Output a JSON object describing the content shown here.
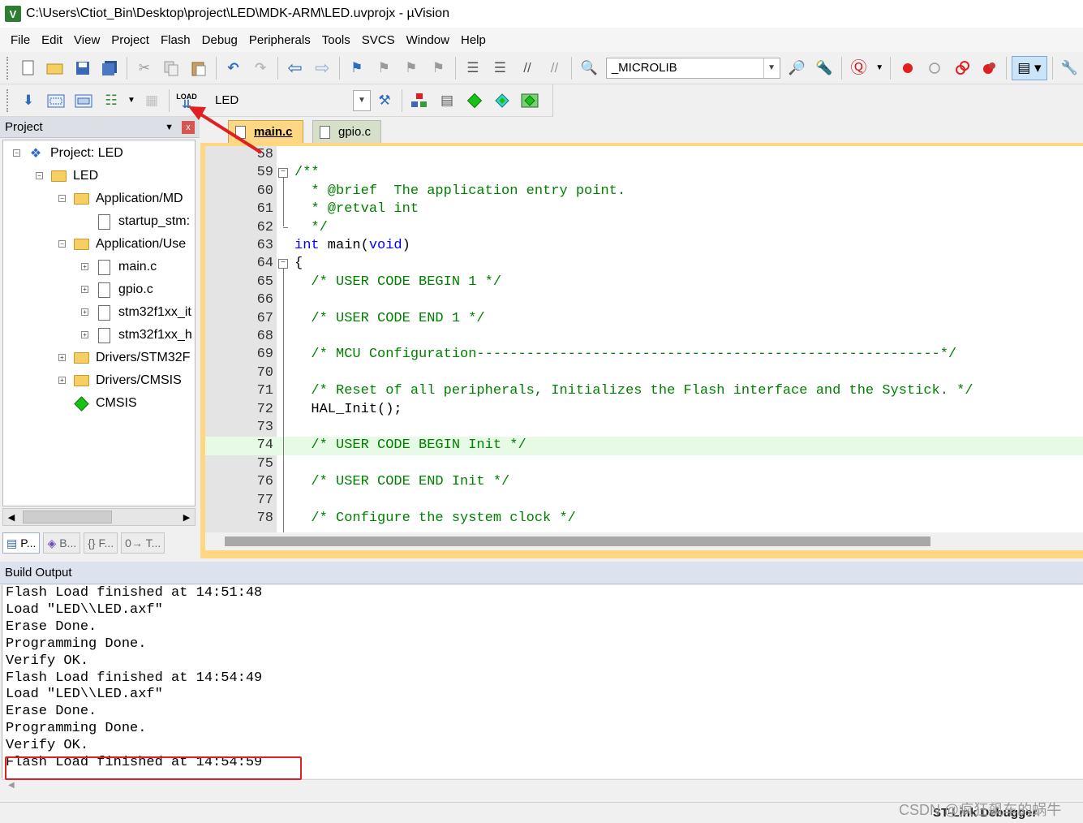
{
  "window": {
    "title": "C:\\Users\\Ctiot_Bin\\Desktop\\project\\LED\\MDK-ARM\\LED.uvprojx - µVision",
    "icon_letter": "V"
  },
  "menu": [
    "File",
    "Edit",
    "View",
    "Project",
    "Flash",
    "Debug",
    "Peripherals",
    "Tools",
    "SVCS",
    "Window",
    "Help"
  ],
  "toolbar1": {
    "target_combo": "_MICROLIB"
  },
  "toolbar2": {
    "load_label": "LOAD",
    "target_combo": "LED"
  },
  "project_panel": {
    "title": "Project",
    "pin_glyph": "▼",
    "close_glyph": "x",
    "tree": [
      {
        "label": "Project: LED",
        "level": 0,
        "icon": "project-icon",
        "toggle": "⊟"
      },
      {
        "label": "LED",
        "level": 1,
        "icon": "target-folder-icon",
        "toggle": "⊟"
      },
      {
        "label": "Application/MD",
        "level": 2,
        "icon": "folder-icon",
        "toggle": "⊟"
      },
      {
        "label": "startup_stm:",
        "level": 3,
        "icon": "file-icon",
        "toggle": ""
      },
      {
        "label": "Application/Use",
        "level": 2,
        "icon": "folder-icon",
        "toggle": "⊟"
      },
      {
        "label": "main.c",
        "level": 3,
        "icon": "file-icon",
        "toggle": "⊞"
      },
      {
        "label": "gpio.c",
        "level": 3,
        "icon": "file-icon",
        "toggle": "⊞"
      },
      {
        "label": "stm32f1xx_it",
        "level": 3,
        "icon": "file-icon",
        "toggle": "⊞"
      },
      {
        "label": "stm32f1xx_h",
        "level": 3,
        "icon": "file-icon",
        "toggle": "⊞"
      },
      {
        "label": "Drivers/STM32F",
        "level": 2,
        "icon": "folder-icon",
        "toggle": "⊞"
      },
      {
        "label": "Drivers/CMSIS",
        "level": 2,
        "icon": "folder-icon",
        "toggle": "⊞"
      },
      {
        "label": "CMSIS",
        "level": 2,
        "icon": "cmsis-diamond-icon",
        "toggle": ""
      }
    ],
    "bottom_tabs": [
      {
        "label": "P...",
        "icon": "project-tab-icon"
      },
      {
        "label": "B...",
        "icon": "books-tab-icon"
      },
      {
        "label": "{} F...",
        "icon": "functions-tab-icon"
      },
      {
        "label": "0→ T...",
        "icon": "templates-tab-icon"
      }
    ]
  },
  "editor": {
    "tabs": [
      {
        "label": "main.c",
        "active": true
      },
      {
        "label": "gpio.c",
        "active": false
      }
    ],
    "lines": [
      {
        "n": "58",
        "parts": []
      },
      {
        "n": "59",
        "fold": "−",
        "parts": [
          {
            "t": "/**",
            "c": "cm"
          }
        ]
      },
      {
        "n": "60",
        "parts": [
          {
            "t": "  * @brief  The application entry point.",
            "c": "cm"
          }
        ]
      },
      {
        "n": "61",
        "parts": [
          {
            "t": "  * @retval int",
            "c": "cm"
          }
        ]
      },
      {
        "n": "62",
        "parts": [
          {
            "t": "  */",
            "c": "cm"
          }
        ]
      },
      {
        "n": "63",
        "parts": [
          {
            "t": "int",
            "c": "kw"
          },
          {
            "t": " main(",
            "c": "plain"
          },
          {
            "t": "void",
            "c": "kw"
          },
          {
            "t": ")",
            "c": "plain"
          }
        ]
      },
      {
        "n": "64",
        "fold": "−",
        "parts": [
          {
            "t": "{",
            "c": "plain"
          }
        ]
      },
      {
        "n": "65",
        "parts": [
          {
            "t": "  /* USER CODE BEGIN 1 */",
            "c": "cm"
          }
        ]
      },
      {
        "n": "66",
        "parts": []
      },
      {
        "n": "67",
        "parts": [
          {
            "t": "  /* USER CODE END 1 */",
            "c": "cm"
          }
        ]
      },
      {
        "n": "68",
        "parts": []
      },
      {
        "n": "69",
        "parts": [
          {
            "t": "  /* MCU Configuration--------------------------------------------------------*/",
            "c": "cm"
          }
        ]
      },
      {
        "n": "70",
        "parts": []
      },
      {
        "n": "71",
        "parts": [
          {
            "t": "  /* Reset of all peripherals, Initializes the Flash interface and the Systick. */",
            "c": "cm"
          }
        ]
      },
      {
        "n": "72",
        "parts": [
          {
            "t": "  HAL_Init();",
            "c": "plain"
          }
        ]
      },
      {
        "n": "73",
        "parts": []
      },
      {
        "n": "74",
        "hl": true,
        "parts": [
          {
            "t": "  /* USER CODE BEGIN Init */",
            "c": "cm"
          }
        ]
      },
      {
        "n": "75",
        "parts": []
      },
      {
        "n": "76",
        "parts": [
          {
            "t": "  /* USER CODE END Init */",
            "c": "cm"
          }
        ]
      },
      {
        "n": "77",
        "parts": []
      },
      {
        "n": "78",
        "parts": [
          {
            "t": "  /* Configure the system clock */",
            "c": "cm"
          }
        ]
      }
    ]
  },
  "build_output": {
    "title": "Build Output",
    "lines": [
      "Flash Load finished at 14:51:48",
      "Load \"LED\\\\LED.axf\"",
      "Erase Done.",
      "Programming Done.",
      "Verify OK.",
      "Flash Load finished at 14:54:49",
      "Load \"LED\\\\LED.axf\"",
      "Erase Done.",
      "Programming Done.",
      "Verify OK.",
      "Flash Load finished at 14:54:59"
    ]
  },
  "status": {
    "debugger": "ST-Link Debugger"
  },
  "watermark": "CSDN @疯狂飙车的蜗牛",
  "colors": {
    "annotation": "#e02020",
    "comment": "#008000",
    "keyword": "#0000ff",
    "editor_frame": "#ffd783",
    "current_line": "#e6fae6"
  }
}
